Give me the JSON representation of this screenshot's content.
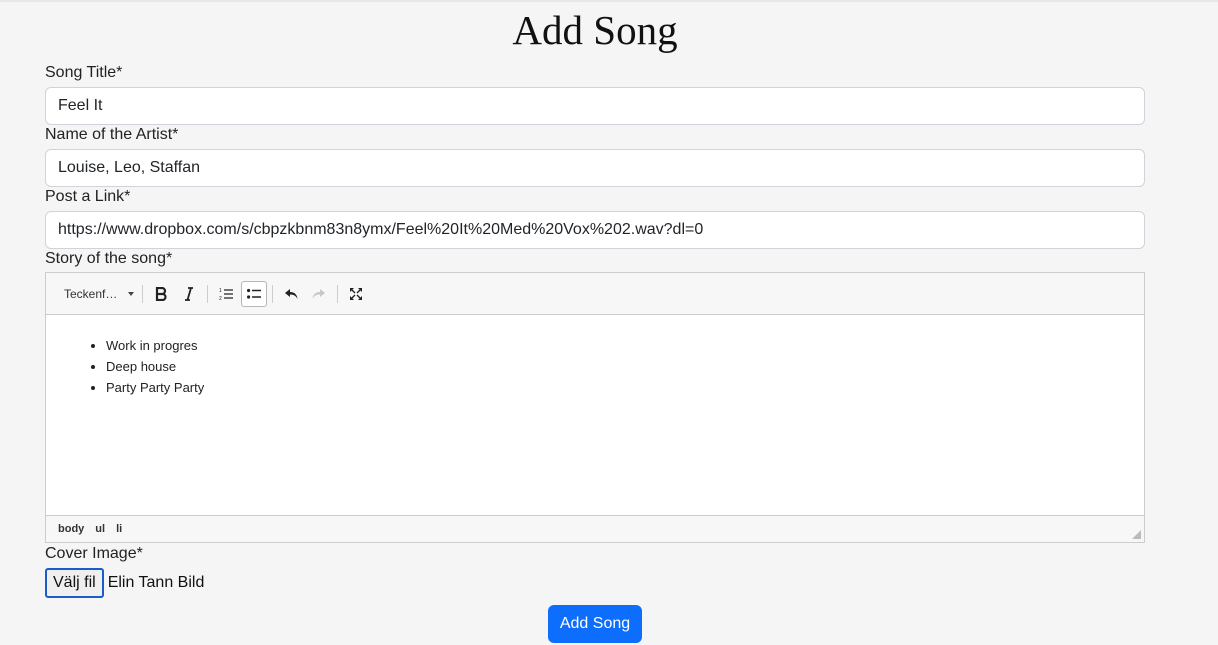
{
  "page": {
    "title": "Add Song"
  },
  "form": {
    "song_title": {
      "label": "Song Title*",
      "value": "Feel It"
    },
    "artist": {
      "label": "Name of the Artist*",
      "value": "Louise, Leo, Staffan"
    },
    "link": {
      "label": "Post a Link*",
      "value": "https://www.dropbox.com/s/cbpzkbnm83n8ymx/Feel%20It%20Med%20Vox%202.wav?dl=0"
    },
    "story": {
      "label": "Story of the song*",
      "toolbar": {
        "font_select": "Teckenf…",
        "buttons": [
          "bold-icon",
          "italic-icon",
          "numbered-list-icon",
          "bulleted-list-icon",
          "undo-icon",
          "redo-icon",
          "fullscreen-icon"
        ]
      },
      "items": [
        "Work in progres",
        "Deep house",
        "Party Party Party"
      ],
      "path": [
        "body",
        "ul",
        "li"
      ]
    },
    "cover": {
      "label": "Cover Image*",
      "button_label": "Välj fil",
      "file_name": "Elin Tann Bild"
    },
    "submit_label": "Add Song"
  },
  "colors": {
    "primary": "#0d6efd",
    "background": "#f5f5f5"
  }
}
